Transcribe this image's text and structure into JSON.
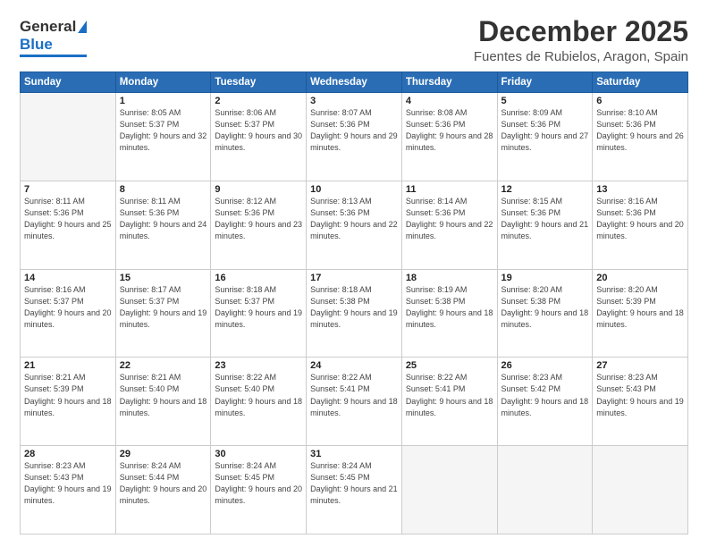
{
  "logo": {
    "general": "General",
    "blue": "Blue"
  },
  "title": "December 2025",
  "subtitle": "Fuentes de Rubielos, Aragon, Spain",
  "weekdays": [
    "Sunday",
    "Monday",
    "Tuesday",
    "Wednesday",
    "Thursday",
    "Friday",
    "Saturday"
  ],
  "weeks": [
    [
      {
        "day": "",
        "empty": true
      },
      {
        "day": "1",
        "sunrise": "Sunrise: 8:05 AM",
        "sunset": "Sunset: 5:37 PM",
        "daylight": "Daylight: 9 hours and 32 minutes."
      },
      {
        "day": "2",
        "sunrise": "Sunrise: 8:06 AM",
        "sunset": "Sunset: 5:37 PM",
        "daylight": "Daylight: 9 hours and 30 minutes."
      },
      {
        "day": "3",
        "sunrise": "Sunrise: 8:07 AM",
        "sunset": "Sunset: 5:36 PM",
        "daylight": "Daylight: 9 hours and 29 minutes."
      },
      {
        "day": "4",
        "sunrise": "Sunrise: 8:08 AM",
        "sunset": "Sunset: 5:36 PM",
        "daylight": "Daylight: 9 hours and 28 minutes."
      },
      {
        "day": "5",
        "sunrise": "Sunrise: 8:09 AM",
        "sunset": "Sunset: 5:36 PM",
        "daylight": "Daylight: 9 hours and 27 minutes."
      },
      {
        "day": "6",
        "sunrise": "Sunrise: 8:10 AM",
        "sunset": "Sunset: 5:36 PM",
        "daylight": "Daylight: 9 hours and 26 minutes."
      }
    ],
    [
      {
        "day": "7",
        "sunrise": "Sunrise: 8:11 AM",
        "sunset": "Sunset: 5:36 PM",
        "daylight": "Daylight: 9 hours and 25 minutes."
      },
      {
        "day": "8",
        "sunrise": "Sunrise: 8:11 AM",
        "sunset": "Sunset: 5:36 PM",
        "daylight": "Daylight: 9 hours and 24 minutes."
      },
      {
        "day": "9",
        "sunrise": "Sunrise: 8:12 AM",
        "sunset": "Sunset: 5:36 PM",
        "daylight": "Daylight: 9 hours and 23 minutes."
      },
      {
        "day": "10",
        "sunrise": "Sunrise: 8:13 AM",
        "sunset": "Sunset: 5:36 PM",
        "daylight": "Daylight: 9 hours and 22 minutes."
      },
      {
        "day": "11",
        "sunrise": "Sunrise: 8:14 AM",
        "sunset": "Sunset: 5:36 PM",
        "daylight": "Daylight: 9 hours and 22 minutes."
      },
      {
        "day": "12",
        "sunrise": "Sunrise: 8:15 AM",
        "sunset": "Sunset: 5:36 PM",
        "daylight": "Daylight: 9 hours and 21 minutes."
      },
      {
        "day": "13",
        "sunrise": "Sunrise: 8:16 AM",
        "sunset": "Sunset: 5:36 PM",
        "daylight": "Daylight: 9 hours and 20 minutes."
      }
    ],
    [
      {
        "day": "14",
        "sunrise": "Sunrise: 8:16 AM",
        "sunset": "Sunset: 5:37 PM",
        "daylight": "Daylight: 9 hours and 20 minutes."
      },
      {
        "day": "15",
        "sunrise": "Sunrise: 8:17 AM",
        "sunset": "Sunset: 5:37 PM",
        "daylight": "Daylight: 9 hours and 19 minutes."
      },
      {
        "day": "16",
        "sunrise": "Sunrise: 8:18 AM",
        "sunset": "Sunset: 5:37 PM",
        "daylight": "Daylight: 9 hours and 19 minutes."
      },
      {
        "day": "17",
        "sunrise": "Sunrise: 8:18 AM",
        "sunset": "Sunset: 5:38 PM",
        "daylight": "Daylight: 9 hours and 19 minutes."
      },
      {
        "day": "18",
        "sunrise": "Sunrise: 8:19 AM",
        "sunset": "Sunset: 5:38 PM",
        "daylight": "Daylight: 9 hours and 18 minutes."
      },
      {
        "day": "19",
        "sunrise": "Sunrise: 8:20 AM",
        "sunset": "Sunset: 5:38 PM",
        "daylight": "Daylight: 9 hours and 18 minutes."
      },
      {
        "day": "20",
        "sunrise": "Sunrise: 8:20 AM",
        "sunset": "Sunset: 5:39 PM",
        "daylight": "Daylight: 9 hours and 18 minutes."
      }
    ],
    [
      {
        "day": "21",
        "sunrise": "Sunrise: 8:21 AM",
        "sunset": "Sunset: 5:39 PM",
        "daylight": "Daylight: 9 hours and 18 minutes."
      },
      {
        "day": "22",
        "sunrise": "Sunrise: 8:21 AM",
        "sunset": "Sunset: 5:40 PM",
        "daylight": "Daylight: 9 hours and 18 minutes."
      },
      {
        "day": "23",
        "sunrise": "Sunrise: 8:22 AM",
        "sunset": "Sunset: 5:40 PM",
        "daylight": "Daylight: 9 hours and 18 minutes."
      },
      {
        "day": "24",
        "sunrise": "Sunrise: 8:22 AM",
        "sunset": "Sunset: 5:41 PM",
        "daylight": "Daylight: 9 hours and 18 minutes."
      },
      {
        "day": "25",
        "sunrise": "Sunrise: 8:22 AM",
        "sunset": "Sunset: 5:41 PM",
        "daylight": "Daylight: 9 hours and 18 minutes."
      },
      {
        "day": "26",
        "sunrise": "Sunrise: 8:23 AM",
        "sunset": "Sunset: 5:42 PM",
        "daylight": "Daylight: 9 hours and 18 minutes."
      },
      {
        "day": "27",
        "sunrise": "Sunrise: 8:23 AM",
        "sunset": "Sunset: 5:43 PM",
        "daylight": "Daylight: 9 hours and 19 minutes."
      }
    ],
    [
      {
        "day": "28",
        "sunrise": "Sunrise: 8:23 AM",
        "sunset": "Sunset: 5:43 PM",
        "daylight": "Daylight: 9 hours and 19 minutes."
      },
      {
        "day": "29",
        "sunrise": "Sunrise: 8:24 AM",
        "sunset": "Sunset: 5:44 PM",
        "daylight": "Daylight: 9 hours and 20 minutes."
      },
      {
        "day": "30",
        "sunrise": "Sunrise: 8:24 AM",
        "sunset": "Sunset: 5:45 PM",
        "daylight": "Daylight: 9 hours and 20 minutes."
      },
      {
        "day": "31",
        "sunrise": "Sunrise: 8:24 AM",
        "sunset": "Sunset: 5:45 PM",
        "daylight": "Daylight: 9 hours and 21 minutes."
      },
      {
        "day": "",
        "empty": true
      },
      {
        "day": "",
        "empty": true
      },
      {
        "day": "",
        "empty": true
      }
    ]
  ]
}
